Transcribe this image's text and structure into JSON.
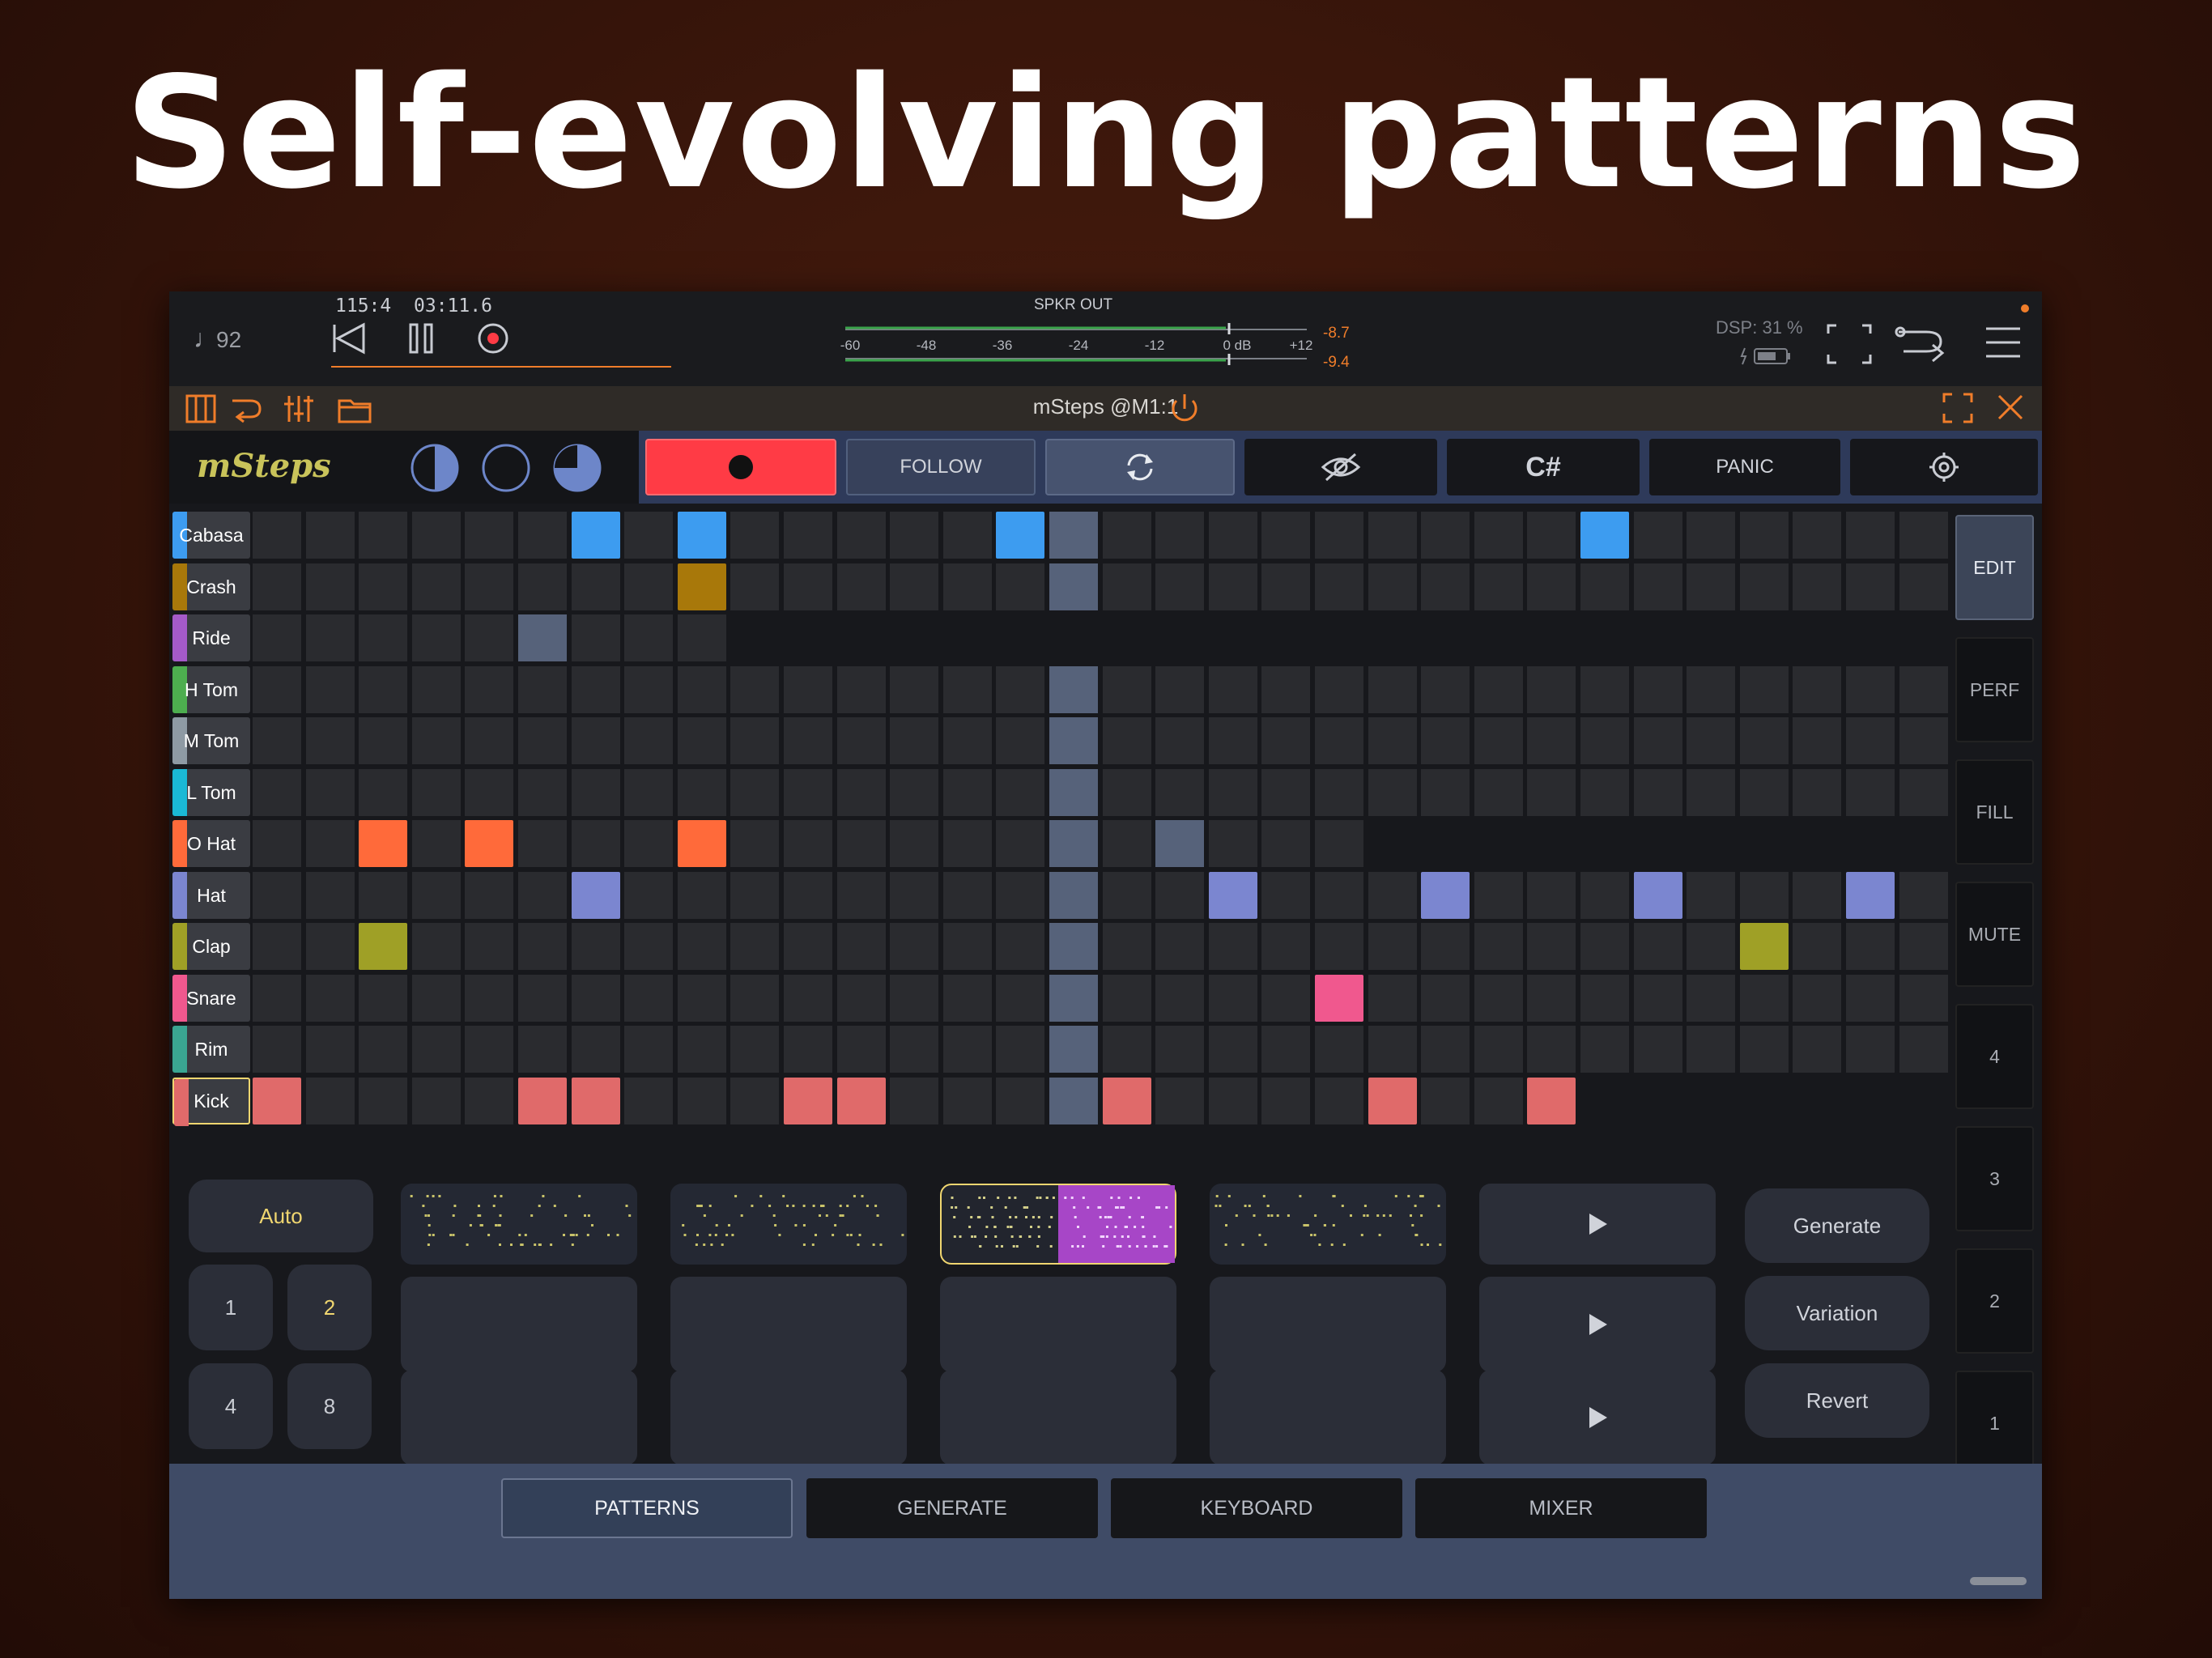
{
  "headline": "Self-evolving patterns",
  "host": {
    "tempo": "92",
    "position": "115:4",
    "time": "03:11.6",
    "meter_label": "SPKR OUT",
    "meter_ticks": [
      "-60",
      "-48",
      "-36",
      "-24",
      "-12",
      "0 dB",
      "+12"
    ],
    "peak_top": "-8.7",
    "peak_bottom": "-9.4",
    "dsp": "DSP: 31 %"
  },
  "plugin": {
    "title": "mSteps @M1:1"
  },
  "app": {
    "logo": "mSteps",
    "toolbar": {
      "follow": "FOLLOW",
      "key": "C#",
      "panic": "PANIC"
    }
  },
  "tracks": [
    {
      "name": "Cabasa",
      "color": "#3d9cf0",
      "length": 32,
      "steps": [
        6,
        8,
        14,
        25
      ]
    },
    {
      "name": "Crash",
      "color": "#a8780a",
      "length": 32,
      "steps": [
        8
      ]
    },
    {
      "name": "Ride",
      "color": "#a45ac8",
      "length": 9,
      "steps": []
    },
    {
      "name": "H Tom",
      "color": "#4dae4f",
      "length": 32,
      "steps": []
    },
    {
      "name": "M Tom",
      "color": "#8e9aa4",
      "length": 32,
      "steps": []
    },
    {
      "name": "L Tom",
      "color": "#1ab9d6",
      "length": 32,
      "steps": []
    },
    {
      "name": "O Hat",
      "color": "#ff6a3a",
      "length": 21,
      "steps": [
        2,
        4,
        8
      ]
    },
    {
      "name": "Hat",
      "color": "#7b86d0",
      "length": 32,
      "steps": [
        6,
        18,
        22,
        26,
        30
      ]
    },
    {
      "name": "Clap",
      "color": "#9fa026",
      "length": 32,
      "steps": [
        2,
        28
      ]
    },
    {
      "name": "Snare",
      "color": "#f0588e",
      "length": 32,
      "steps": [
        20
      ]
    },
    {
      "name": "Rim",
      "color": "#3aa592",
      "length": 32,
      "steps": []
    },
    {
      "name": "Kick",
      "color": "#e06a6a",
      "length": 25,
      "steps": [
        0,
        5,
        6,
        10,
        11,
        16,
        21,
        24
      ]
    }
  ],
  "playhead_step": 15,
  "playhead_extra": [
    {
      "row": 2,
      "step": 5
    },
    {
      "row": 6,
      "step": 17
    }
  ],
  "right_buttons": [
    "EDIT",
    "PERF",
    "FILL",
    "MUTE",
    "4",
    "3",
    "2",
    "1"
  ],
  "left_controls": {
    "auto": "Auto",
    "lengths": [
      "1",
      "2",
      "4",
      "8"
    ],
    "selected_length": "2"
  },
  "actions": [
    "Generate",
    "Variation",
    "Revert"
  ],
  "tabs": [
    "PATTERNS",
    "GENERATE",
    "KEYBOARD",
    "MIXER"
  ],
  "colors": {
    "record": "#ff3b45",
    "accent": "#f07d2a",
    "active_tab": "#334058",
    "bottom_bar": "#3f4b66"
  }
}
